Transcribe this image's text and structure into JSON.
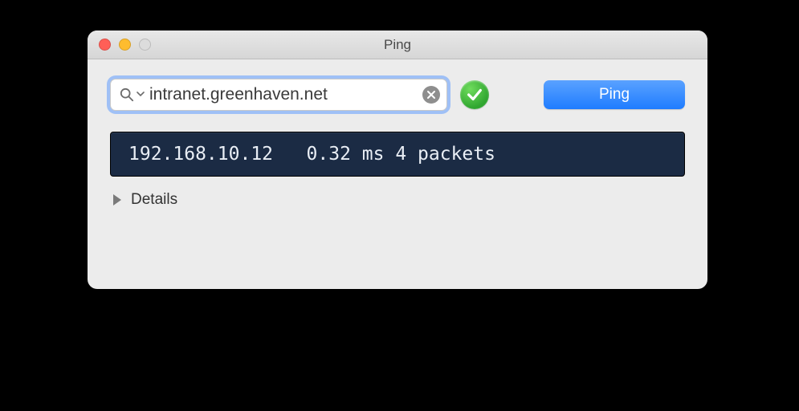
{
  "window": {
    "title": "Ping"
  },
  "search": {
    "value": "intranet.greenhaven.net",
    "placeholder": ""
  },
  "status": {
    "state": "success"
  },
  "action": {
    "label": "Ping"
  },
  "result": {
    "ip": "192.168.10.12",
    "latency": "0.32 ms",
    "packets": "4 packets",
    "display": "192.168.10.12   0.32 ms 4 packets"
  },
  "details": {
    "label": "Details",
    "expanded": false
  }
}
